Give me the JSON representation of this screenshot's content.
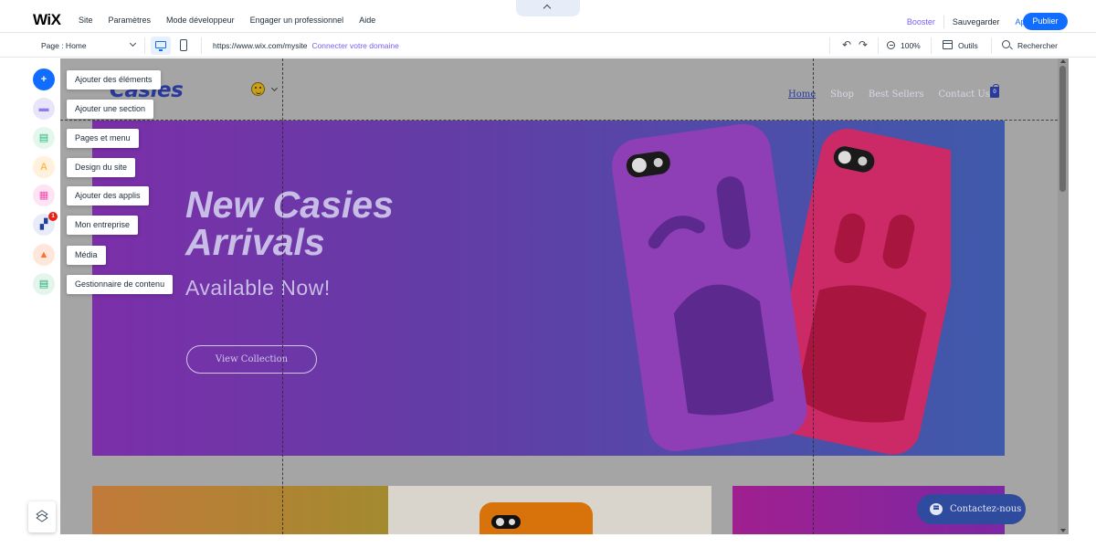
{
  "topbar": {
    "logo": "WiX",
    "menu": [
      "Site",
      "Paramètres",
      "Mode développeur",
      "Engager un professionnel",
      "Aide"
    ],
    "booster": "Booster",
    "save": "Sauvegarder",
    "preview": "Aperçu",
    "publish": "Publier"
  },
  "secondbar": {
    "page": "Page : Home",
    "url": "https://www.wix.com/mysite",
    "connect": "Connecter votre domaine",
    "zoom": "100%",
    "tools": "Outils",
    "search": "Rechercher"
  },
  "rail": {
    "items": [
      {
        "label": "Ajouter des éléments",
        "icon": "plus-icon",
        "color": "#116dff",
        "glyph": "+"
      },
      {
        "label": "Ajouter une section",
        "icon": "section-icon",
        "color": "#8b7be6",
        "glyph": "▬"
      },
      {
        "label": "Pages et menu",
        "icon": "page-icon",
        "color": "#22b573",
        "glyph": "▤"
      },
      {
        "label": "Design du site",
        "icon": "design-icon",
        "color": "#ffb84d",
        "glyph": "A"
      },
      {
        "label": "Ajouter des applis",
        "icon": "apps-icon",
        "color": "#f24bb1",
        "glyph": "▦"
      },
      {
        "label": "Mon entreprise",
        "icon": "business-icon",
        "color": "#1f3f9b",
        "glyph": "▞"
      },
      {
        "label": "Média",
        "icon": "media-icon",
        "color": "#ff7034",
        "glyph": "▲"
      },
      {
        "label": "Gestionnaire de contenu",
        "icon": "cms-icon",
        "color": "#28a86b",
        "glyph": "▤"
      }
    ],
    "badge": "1"
  },
  "site": {
    "logo": "Casies",
    "nav": [
      "Home",
      "Shop",
      "Best Sellers",
      "Contact Us"
    ],
    "cart_count": "0",
    "hero_title": "New Casies\nArrivals",
    "hero_subtitle": "Available Now!",
    "hero_cta": "View Collection",
    "contact": "Contactez-nous"
  },
  "colors": {
    "accent": "#116dff",
    "brand": "#7a5cf5"
  }
}
